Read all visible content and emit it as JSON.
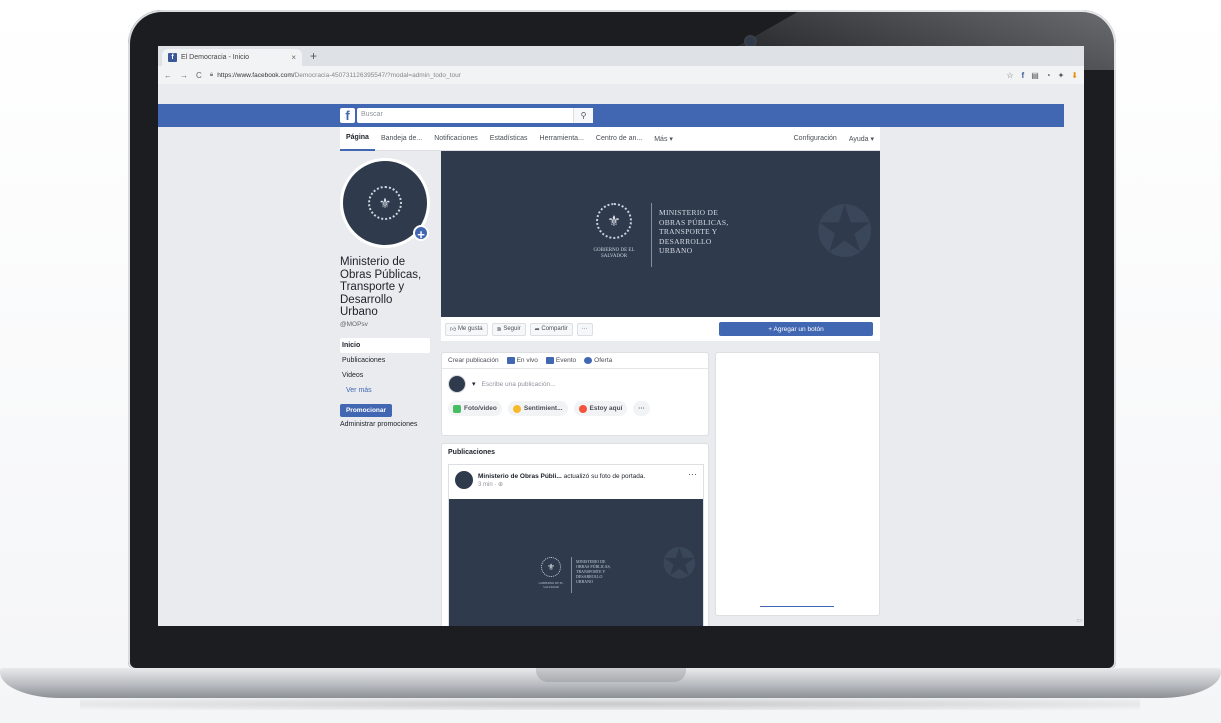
{
  "browser": {
    "tab_title": "El Democracia - Inicio",
    "tab_close": "×",
    "new_tab": "+",
    "nav_back": "←",
    "nav_forward": "→",
    "nav_reload": "C",
    "url_host": "https://www.facebook.com/",
    "url_path": "Democracia-450731126395547/?modal=admin_todo_tour",
    "star": "☆",
    "extensions": [
      "f",
      "▤",
      "◔",
      "✦",
      "⬇"
    ]
  },
  "fb_header": {
    "logo": "f",
    "search_placeholder": "Buscar",
    "search_icon": "⚲"
  },
  "page_nav": {
    "items": [
      "Página",
      "Bandeja de...",
      "Notificaciones",
      "Estadísticas",
      "Herramienta...",
      "Centro de an...",
      "Más ▾"
    ],
    "right_items": [
      "Configuración",
      "Ayuda ▾"
    ]
  },
  "left": {
    "page_name": "Ministerio de Obras Públicas, Transporte y Desarrollo Urbano",
    "handle": "@MOPsv",
    "nav": [
      "Inicio",
      "Publicaciones",
      "Videos",
      "Ver más"
    ],
    "promote_label": "Promocionar",
    "manage_promotions": "Administrar promociones"
  },
  "cover": {
    "gob_text": "GOBIERNO DE EL SALVADOR",
    "ministry_lines": [
      "MINISTERIO DE",
      "OBRAS PÚBLICAS,",
      "TRANSPORTE Y",
      "DESARROLLO",
      "URBANO"
    ]
  },
  "actions": {
    "like": "Me gusta",
    "follow": "Seguir",
    "share": "Compartir",
    "more": "···",
    "add_button": "+ Agregar un botón"
  },
  "composer": {
    "tabs": [
      "Crear publicación",
      "En vivo",
      "Evento",
      "Oferta"
    ],
    "placeholder": "Escribe una publicación...",
    "options": [
      "Foto/video",
      "Sentimient...",
      "Estoy aquí",
      "···"
    ]
  },
  "posts": {
    "title": "Publicaciones",
    "post_author": "Ministerio de Obras Públi...",
    "post_action": "actualizó su foto de portada.",
    "post_time": "3 min · ⊕",
    "post_more": "···",
    "img_gob_text": "GOBIERNO DE EL SALVADOR",
    "img_ministry_lines": [
      "MINISTERIO DE",
      "OBRAS PÚBLICAS,",
      "TRANSPORTE Y",
      "DESARROLLO",
      "URBANO"
    ]
  },
  "colors": {
    "fb_blue": "#4267b2",
    "cover_navy": "#2f3a4c",
    "page_bg": "#e9ebee"
  }
}
